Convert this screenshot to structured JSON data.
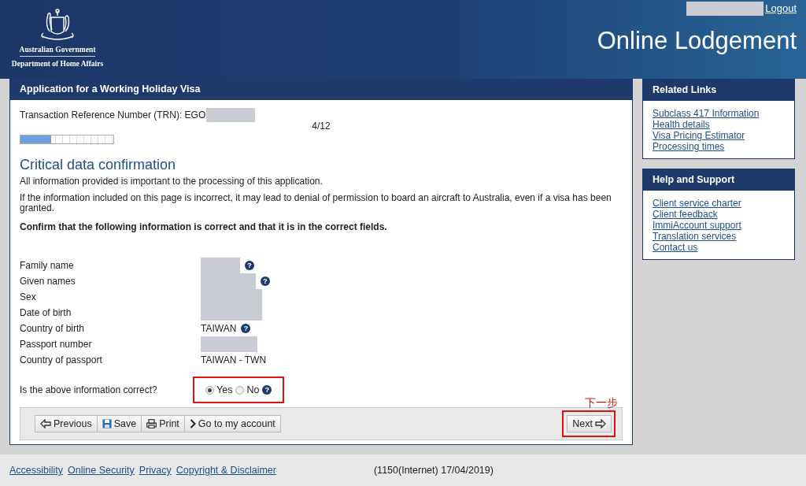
{
  "header": {
    "agency_line_1": "Australian Government",
    "agency_line_2": "Department of Home Affairs",
    "logout": "Logout",
    "title": "Online Lodgement"
  },
  "main": {
    "panel_title": "Application for a Working Holiday Visa",
    "trn_label": "Transaction Reference Number (TRN): EGO",
    "page_counter": "4/12",
    "progress": {
      "level": 0.33
    },
    "heading": "Critical data confirmation",
    "paragraphs": [
      "All information provided is important to the processing of this application.",
      "If the information included on this page is incorrect, it may lead to denial of permission to board an aircraft to Australia, even if a visa has been granted."
    ],
    "instruction": "Confirm that the following information is correct and that it is in the correct fields.",
    "fields": [
      {
        "label": "Family name",
        "kind": "redacted",
        "help": "?"
      },
      {
        "label": "Given names",
        "kind": "redacted",
        "help": "?"
      },
      {
        "label": "Sex",
        "kind": "redacted"
      },
      {
        "label": "Date of birth",
        "kind": "redacted"
      },
      {
        "label": "Country of birth",
        "kind": "text",
        "value": "TAIWAN",
        "help": "?"
      },
      {
        "label": "Passport number",
        "kind": "redacted"
      },
      {
        "label": "Country of passport",
        "kind": "text",
        "value": "TAIWAN - TWN"
      }
    ],
    "question": {
      "label": "Is the above information correct?",
      "highlighted": true,
      "help": "?",
      "options": [
        {
          "label": "Yes",
          "selected": true
        },
        {
          "label": "No",
          "selected": false
        }
      ]
    },
    "buttons": [
      {
        "label": "Previous",
        "kind": "back"
      },
      {
        "label": "Save",
        "kind": "save"
      },
      {
        "label": "Print",
        "kind": "print"
      },
      {
        "label": "Go to my account",
        "kind": "account"
      }
    ],
    "annotation": "下一步",
    "next": {
      "label": "Next",
      "highlighted": true
    }
  },
  "sidebar": [
    {
      "title": "Related Links",
      "links": [
        "Subclass 417 Information",
        "Health details",
        "Visa Pricing Estimator",
        "Processing times"
      ]
    },
    {
      "title": "Help and Support",
      "links": [
        "Client service charter",
        "Client feedback",
        "ImmiAccount support",
        "Translation services",
        "Contact us"
      ]
    }
  ],
  "footer": {
    "links": [
      "Accessibility",
      "Online Security",
      "Privacy",
      "Copyright & Disclaimer"
    ],
    "info": "(1150(Internet) 17/04/2019)"
  }
}
